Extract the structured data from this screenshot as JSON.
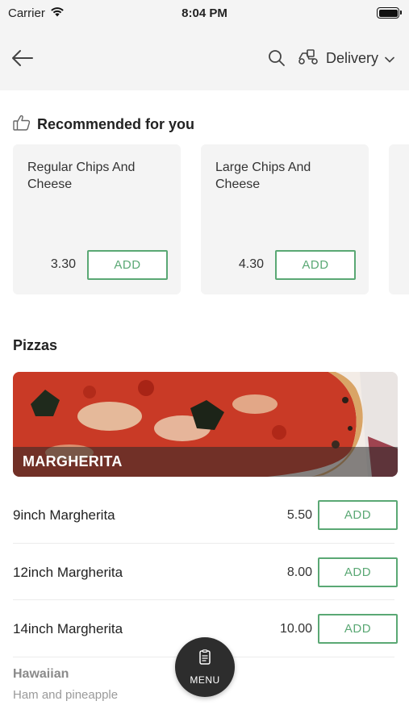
{
  "status_bar": {
    "carrier": "Carrier",
    "time": "8:04 PM"
  },
  "header": {
    "delivery_label": "Delivery"
  },
  "recommended": {
    "title": "Recommended for you",
    "items": [
      {
        "name": "Regular Chips And Cheese",
        "price": "3.30",
        "add_label": "ADD"
      },
      {
        "name": "Large Chips And Cheese",
        "price": "4.30",
        "add_label": "ADD"
      }
    ]
  },
  "pizzas": {
    "title": "Pizzas",
    "banner_label": "MARGHERITA",
    "items": [
      {
        "name": "9inch Margherita",
        "price": "5.50",
        "add_label": "ADD"
      },
      {
        "name": "12inch Margherita",
        "price": "8.00",
        "add_label": "ADD"
      },
      {
        "name": "14inch Margherita",
        "price": "10.00",
        "add_label": "ADD"
      }
    ],
    "next_group": {
      "name": "Hawaiian",
      "description": "Ham and pineapple"
    }
  },
  "menu_button": {
    "label": "MENU"
  },
  "colors": {
    "accent": "#5aa874",
    "header_bg": "#f4f4f4",
    "fab_bg": "#2d2d2d"
  },
  "icons": [
    "wifi-icon",
    "battery-icon",
    "back-arrow-icon",
    "search-icon",
    "scooter-icon",
    "chevron-down-icon",
    "thumbs-up-icon",
    "menu-list-icon"
  ]
}
